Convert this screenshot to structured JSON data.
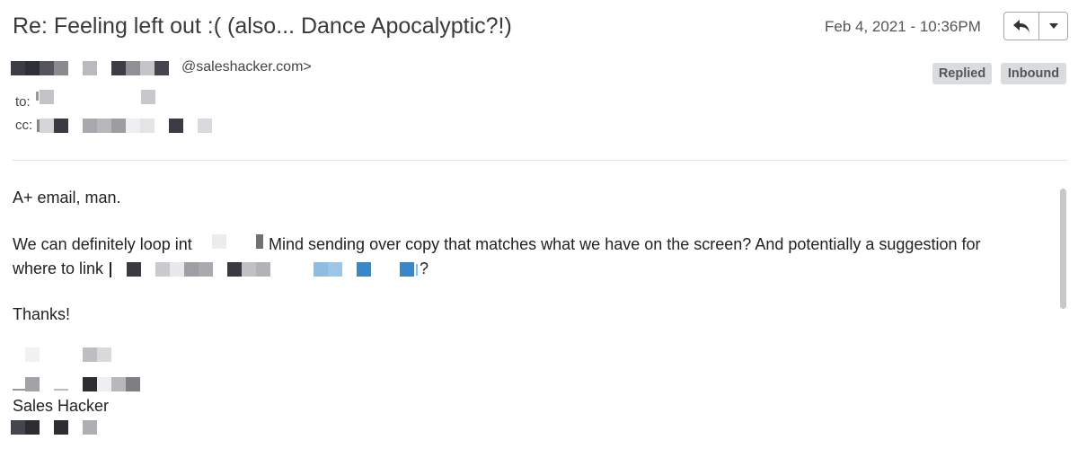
{
  "header": {
    "subject": "Re: Feeling left out :( (also... Dance Apocalyptic?!)",
    "datetime": "Feb 4, 2021 - 10:36PM",
    "reply_icon": "reply-arrow-icon",
    "menu_icon": "chevron-down-icon"
  },
  "from": {
    "domain": "@saleshacker.com>"
  },
  "badges": {
    "replied": "Replied",
    "inbound": "Inbound"
  },
  "recipients": {
    "to_label": "to:",
    "cc_label": "cc:"
  },
  "body": {
    "greeting": "A+ email, man.",
    "line1_start": "We can definitely loop int",
    "line1_end": "Mind sending over copy that matches what we have on the screen? And potentially a suggestion for",
    "line2_start": "where to link",
    "line2_end": "?",
    "thanks": "Thanks!",
    "signature_company": "Sales Hacker"
  },
  "colors": {
    "badge_bg": "#d8dcde",
    "link_blue": "#3a87c8",
    "redact_dark": "#3d3d45"
  }
}
